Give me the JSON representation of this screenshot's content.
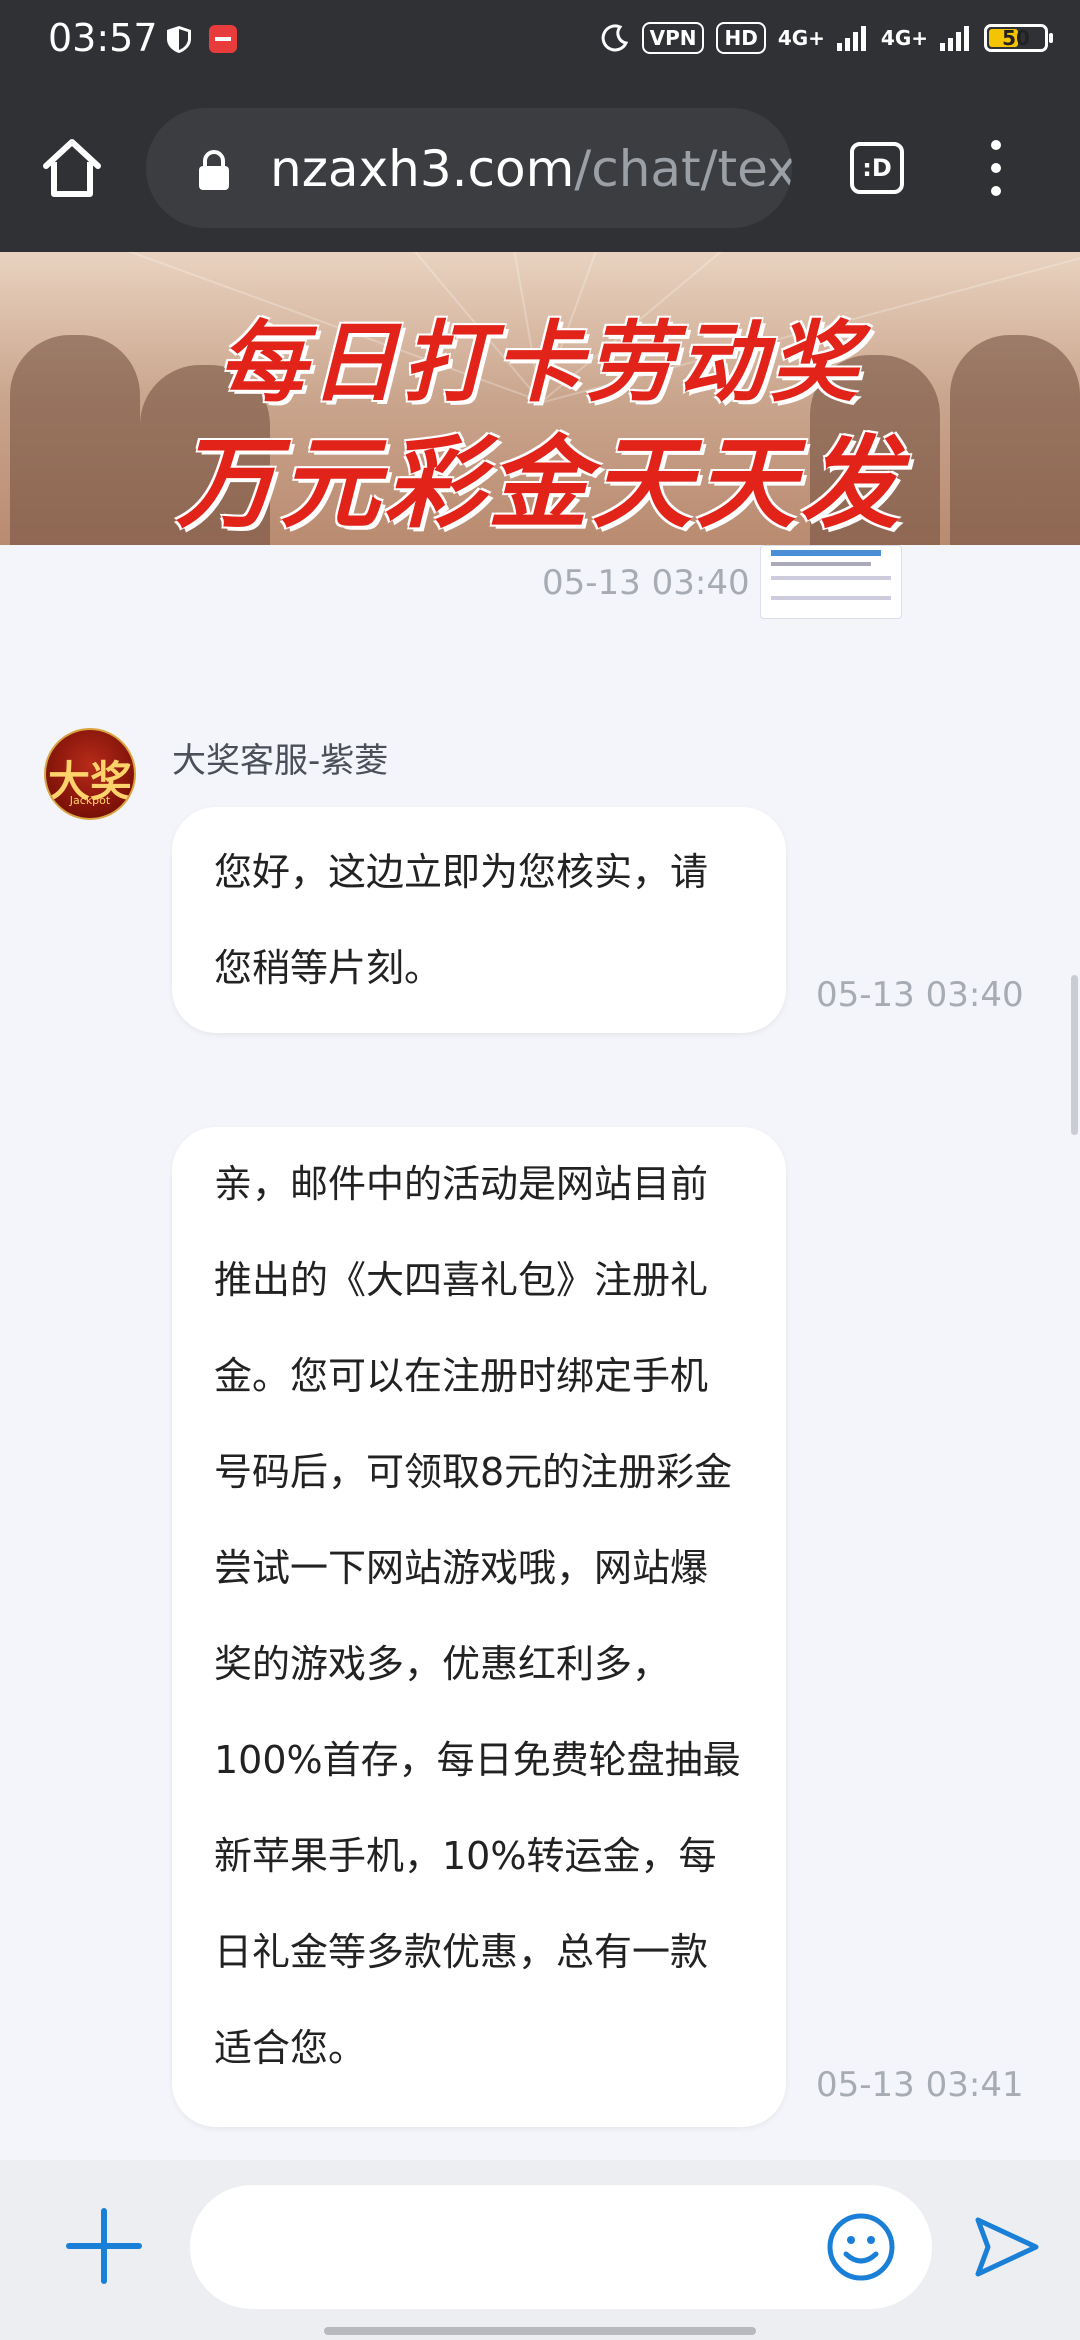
{
  "status_bar": {
    "time": "03:57",
    "vpn": "VPN",
    "hd": "HD",
    "net1": "4G+",
    "net2": "4G+",
    "battery": "50"
  },
  "browser": {
    "url_domain": "nzaxh3.com",
    "url_path": "/chat/text",
    "tabs_label": ":D"
  },
  "banner": {
    "line1": "每日打卡劳动奖",
    "line2": "万元彩金天天发"
  },
  "chat": {
    "image_time": "05-13 03:40",
    "avatar_text": "大奖",
    "avatar_sub": "Jackpot",
    "sender": "大奖客服-紫菱",
    "messages": [
      {
        "lines": [
          "您好，这边立即为您核实，请",
          "您稍等片刻。"
        ],
        "time": "05-13 03:40"
      },
      {
        "lines": [
          "亲，邮件中的活动是网站目前",
          "推出的《大四喜礼包》注册礼",
          "金。您可以在注册时绑定手机",
          "号码后，可领取8元的注册彩金",
          "尝试一下网站游戏哦，网站爆",
          "奖的游戏多，优惠红利多，",
          "100%首存，每日免费轮盘抽最",
          "新苹果手机，10%转运金，每",
          "日礼金等多款优惠，总有一款",
          "适合您。"
        ],
        "time": "05-13 03:41"
      }
    ]
  },
  "composer": {
    "placeholder": ""
  },
  "colors": {
    "accent": "#1a7fd6",
    "banner_text": "#e2231a",
    "topbar": "#303134"
  }
}
